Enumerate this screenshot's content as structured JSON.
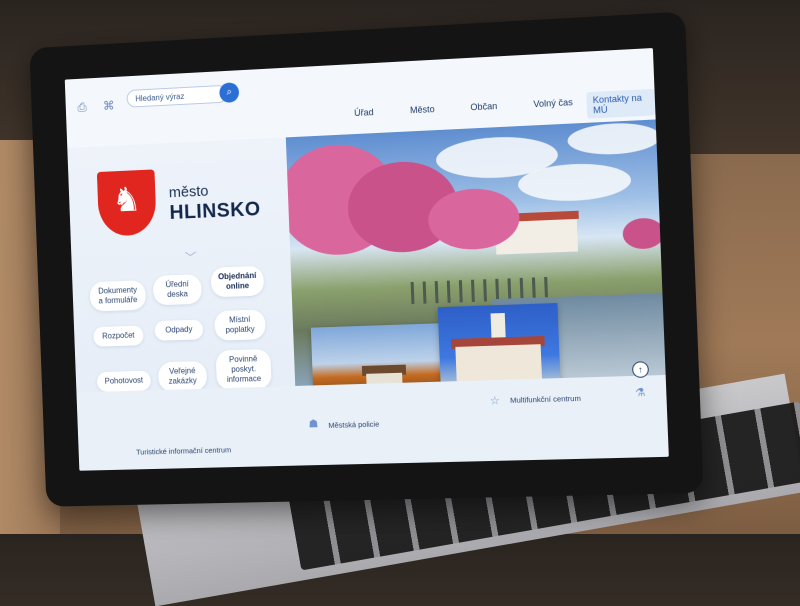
{
  "search": {
    "placeholder": "Hledaný výraz"
  },
  "nav": {
    "items": [
      "Úřad",
      "Město",
      "Občan",
      "Volný čas"
    ],
    "active": "Kontakty na MÚ"
  },
  "brand": {
    "prefix": "město",
    "name": "HLINSKO"
  },
  "quicklinks": [
    {
      "label": "Dokumenty a formuláře"
    },
    {
      "label": "Úřední deska"
    },
    {
      "label": "Objednání online"
    },
    {
      "label": "Rozpočet"
    },
    {
      "label": "Odpady"
    },
    {
      "label": "Místní poplatky"
    },
    {
      "label": "Pohotovost"
    },
    {
      "label": "Veřejné zakázky"
    },
    {
      "label": "Povinně poskyt. informace"
    }
  ],
  "footer_links": {
    "tic": "Turistické informační centrum",
    "police": "Městská policie",
    "mfc": "Multifunkční centrum"
  },
  "colors": {
    "accent": "#2b6fd6",
    "crest": "#e0261f",
    "navy": "#13284d"
  }
}
